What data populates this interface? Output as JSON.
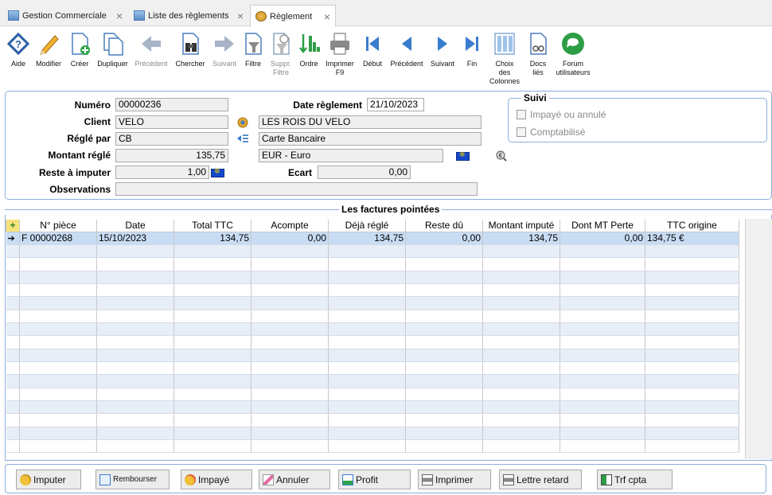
{
  "tabs": [
    {
      "label": "Gestion Commerciale",
      "active": false
    },
    {
      "label": "Liste des règlements",
      "active": false
    },
    {
      "label": "Règlement",
      "active": true
    }
  ],
  "toolbar": {
    "aide": "Aide",
    "modifier": "Modifier",
    "creer": "Créer",
    "dupliquer": "Dupliquer",
    "precedent_dis": "Précédent",
    "chercher": "Chercher",
    "suivant_dis": "Suivant",
    "filtre": "Filtre",
    "suppr1": "Suppr.",
    "suppr2": "Filtre",
    "ordre": "Ordre",
    "imprimer1": "Imprimer",
    "imprimer2": "F9",
    "debut": "Début",
    "precedent": "Précédent",
    "suivant": "Suivant",
    "fin": "Fin",
    "choix1": "Choix",
    "choix2": "des",
    "choix3": "Colonnes",
    "docs1": "Docs",
    "docs2": "liés",
    "forum1": "Forum",
    "forum2": "utilisateurs"
  },
  "form": {
    "numero_label": "Numéro",
    "numero": "00000236",
    "date_label": "Date règlement",
    "date": "21/10/2023",
    "client_label": "Client",
    "client_code": "VELO",
    "client_name": "LES ROIS DU VELO",
    "regle_label": "Réglé par",
    "regle_code": "CB",
    "regle_name": "Carte Bancaire",
    "montant_label": "Montant réglé",
    "montant": "135,75",
    "devise": "EUR - Euro",
    "reste_label": "Reste à imputer",
    "reste": "1,00",
    "ecart_label": "Ecart",
    "ecart": "0,00",
    "obs_label": "Observations",
    "observations": ""
  },
  "suivi": {
    "title": "Suivi",
    "impaye": "Impayé ou annulé",
    "compta": "Comptabilisé"
  },
  "factures": {
    "title": "Les factures pointées",
    "columns": [
      "N° pièce",
      "Date",
      "Total TTC",
      "Acompte",
      "Déjà réglé",
      "Reste dû",
      "Montant imputé",
      "Dont MT Perte",
      "TTC origine"
    ],
    "rows": [
      [
        "F 00000268",
        "15/10/2023",
        "134,75",
        "0,00",
        "134,75",
        "0,00",
        "134,75",
        "0,00",
        "134,75 €"
      ]
    ]
  },
  "buttons": {
    "imputer": "Imputer",
    "rembourser": "Rembourser",
    "impaye": "Impayé",
    "annuler": "Annuler",
    "profit": "Profit",
    "imprimer": "Imprimer",
    "lettre": "Lettre retard",
    "trf": "Trf cpta"
  },
  "colors": {
    "accent": "#8ab0dc",
    "selected_row": "#c8dcf4",
    "alt_row": "#e7eef8"
  }
}
